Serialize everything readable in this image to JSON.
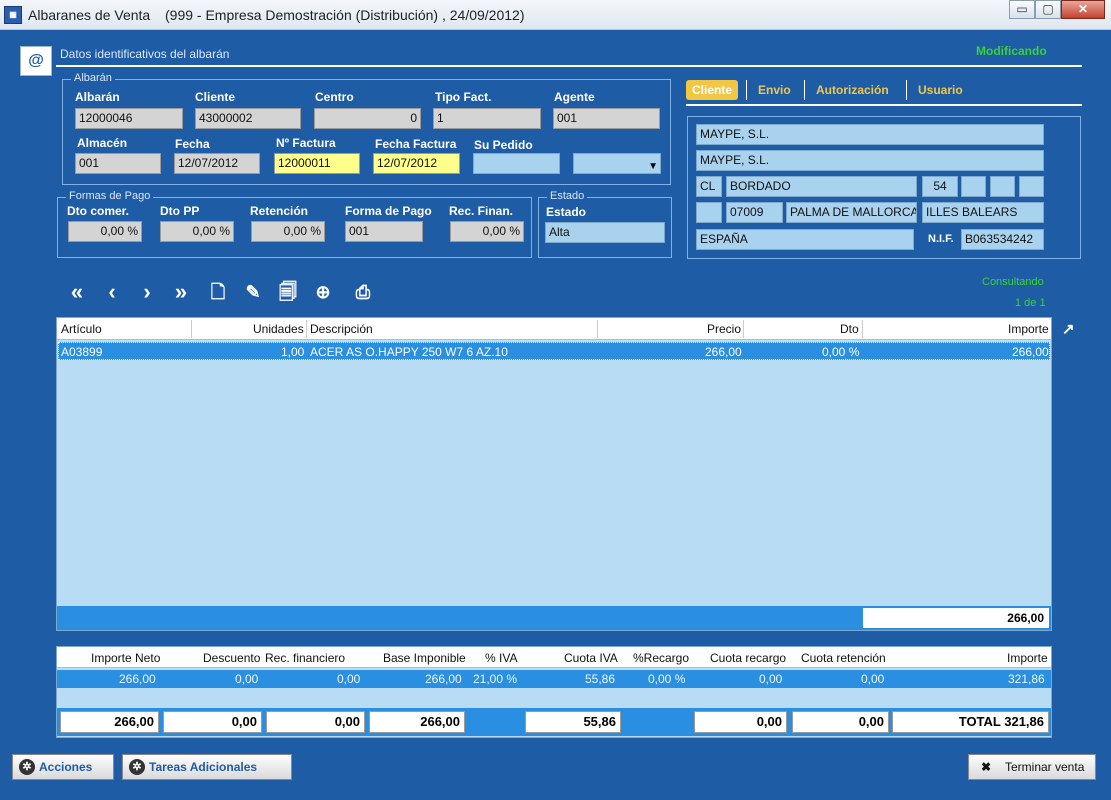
{
  "window": {
    "app_title": "Albaranes de Venta",
    "subtitle": "(999 - Empresa Demostración (Distribución) , 24/09/2012)",
    "minimize": "▭",
    "maximize": "▢",
    "close": "✕"
  },
  "header": {
    "title": "Datos identificativos del albarán",
    "mode": "Modificando"
  },
  "albaran": {
    "legend": "Albarán",
    "albaran_label": "Albarán",
    "albaran_value": "12000046",
    "cliente_label": "Cliente",
    "cliente_value": "43000002",
    "centro_label": "Centro",
    "centro_value": "0",
    "tipo_label": "Tipo Fact.",
    "tipo_value": "1",
    "agente_label": "Agente",
    "agente_value": "001",
    "almacen_label": "Almacén",
    "almacen_value": "001",
    "fecha_label": "Fecha",
    "fecha_value": "12/07/2012",
    "nfactura_label": "Nº Factura",
    "nfactura_value": "12000011",
    "fecha_factura_label": "Fecha Factura",
    "fecha_factura_value": "12/07/2012",
    "su_pedido_label": "Su Pedido",
    "su_pedido_value": ""
  },
  "pago": {
    "legend": "Formas de Pago",
    "dto_comer_label": "Dto comer.",
    "dto_comer_value": "0,00 %",
    "dto_pp_label": "Dto PP",
    "dto_pp_value": "0,00 %",
    "retencion_label": "Retención",
    "retencion_value": "0,00 %",
    "forma_label": "Forma de Pago",
    "forma_value": "001",
    "rec_label": "Rec. Finan.",
    "rec_value": "0,00 %"
  },
  "estado": {
    "legend": "Estado",
    "label": "Estado",
    "value": "Alta"
  },
  "tabs": [
    "Cliente",
    "Envio",
    "Autorización",
    "Usuario"
  ],
  "cliente": {
    "nombre1": "MAYPE, S.L.",
    "nombre2": "MAYPE, S.L.",
    "via": "CL",
    "calle": "BORDADO",
    "numero": "54",
    "cp": "07009",
    "poblacion": "PALMA DE MALLORCA",
    "provincia": "ILLES BALEARS",
    "pais": "ESPAÑA",
    "nif_label": "N.I.F.",
    "nif_value": "B063534242"
  },
  "toolbar": {
    "status": "Consultando",
    "pager": "1 de 1",
    "icons": [
      "first-icon",
      "prev-icon",
      "next-icon",
      "last-icon",
      "new-doc-icon",
      "edit-icon",
      "copy-doc-icon",
      "add-doc-icon",
      "print-icon"
    ]
  },
  "lines": {
    "headers": [
      "Artículo",
      "Unidades",
      "Descripción",
      "Precio",
      "Dto",
      "Importe"
    ],
    "rows": [
      {
        "articulo": "A03899",
        "unidades": "1,00",
        "descripcion": "ACER AS O.HAPPY 250 W7 6 AZ.10",
        "precio": "266,00",
        "dto": "0,00 %",
        "importe": "266,00"
      }
    ],
    "total": "266,00"
  },
  "totals": {
    "headers": [
      "Importe Neto",
      "Descuento",
      "Rec. financiero",
      "Base Imponible",
      "% IVA",
      "Cuota IVA",
      "%Recargo",
      "Cuota recargo",
      "Cuota retención",
      "Importe"
    ],
    "row": [
      "266,00",
      "0,00",
      "0,00",
      "266,00",
      "21,00 %",
      "55,86",
      "0,00 %",
      "0,00",
      "0,00",
      "321,86"
    ],
    "footer": {
      "neto": "266,00",
      "descuento": "0,00",
      "rec": "0,00",
      "base": "266,00",
      "cuota_iva": "55,86",
      "cuota_recargo": "0,00",
      "cuota_retencion": "0,00",
      "total": "TOTAL 321,86"
    }
  },
  "buttons": {
    "acciones": "Acciones",
    "tareas": "Tareas Adicionales",
    "terminar": "Terminar venta"
  },
  "colors": {
    "frame": "#1f5ca6",
    "grid": "#b8dcf3",
    "selected": "#2a8fe0",
    "accent": "#f2c744",
    "status": "#39d139",
    "highlight_field": "#ffff8c"
  }
}
